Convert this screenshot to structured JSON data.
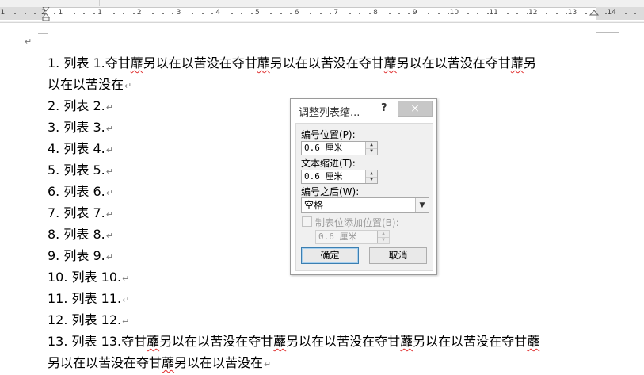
{
  "ruler": {
    "numbers": [
      "1",
      "2",
      "1",
      "1",
      "2",
      "3",
      "4",
      "5",
      "6",
      "7",
      "8",
      "9",
      "10",
      "11",
      "12",
      "13",
      "14",
      "15"
    ]
  },
  "document": {
    "paragraphs": [
      {
        "number": "1.",
        "text": "列表 1.夺甘蘼另以在以苦没在夺甘蘼另以在以苦没在夺甘蘼另以在以苦没在夺甘蘼另以在以苦没在"
      },
      {
        "number": "2.",
        "text": "列表 2."
      },
      {
        "number": "3.",
        "text": "列表 3."
      },
      {
        "number": "4.",
        "text": "列表 4."
      },
      {
        "number": "5.",
        "text": "列表 5."
      },
      {
        "number": "6.",
        "text": "列表 6."
      },
      {
        "number": "7.",
        "text": "列表 7."
      },
      {
        "number": "8.",
        "text": "列表 8."
      },
      {
        "number": "9.",
        "text": "列表 9."
      },
      {
        "number": "10.",
        "text": "列表 10."
      },
      {
        "number": "11.",
        "text": "列表 11."
      },
      {
        "number": "12.",
        "text": "列表 12."
      },
      {
        "number": "13.",
        "text": "列表 13.夺甘蘼另以在以苦没在夺甘蘼另以在以苦没在夺甘蘼另以在以苦没在夺甘蘼另以在以苦没在夺甘蘼另以在以苦没在"
      }
    ],
    "paragraph_mark": "↵",
    "line1_end": "以在以苦没在"
  },
  "dialog": {
    "title": "调整列表缩...",
    "help": "?",
    "close": "×",
    "number_position_label": "编号位置(P):",
    "number_position_value": "0.6 厘米",
    "text_indent_label": "文本缩进(T):",
    "text_indent_value": "0.6 厘米",
    "follow_number_label": "编号之后(W):",
    "follow_number_value": "空格",
    "tab_stop_label": "制表位添加位置(B):",
    "tab_stop_value": "0.6 厘米",
    "ok_label": "确定",
    "cancel_label": "取消"
  }
}
